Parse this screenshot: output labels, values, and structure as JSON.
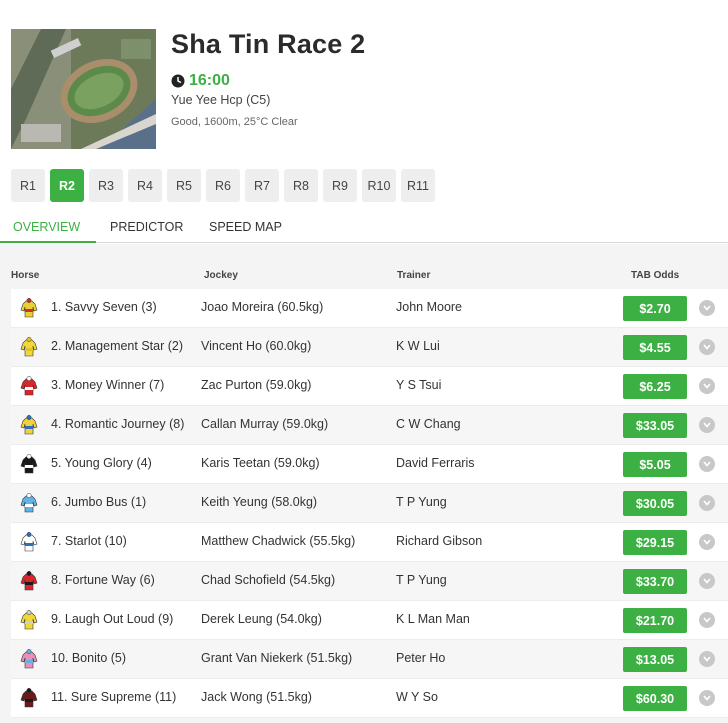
{
  "race": {
    "title": "Sha Tin Race 2",
    "time": "16:00",
    "name": "Yue Yee Hcp (C5)",
    "conditions": "Good, 1600m, 25°C Clear"
  },
  "race_tabs": [
    "R1",
    "R2",
    "R3",
    "R4",
    "R5",
    "R6",
    "R7",
    "R8",
    "R9",
    "R10",
    "R11"
  ],
  "active_race": "R2",
  "view_tabs": [
    "OVERVIEW",
    "PREDICTOR",
    "SPEED MAP"
  ],
  "active_view": "OVERVIEW",
  "columns": {
    "horse": "Horse",
    "jockey": "Jockey",
    "trainer": "Trainer",
    "odds": "TAB Odds"
  },
  "runners": [
    {
      "horse": "1. Savvy Seven (3)",
      "jockey": "Joao Moreira (60.5kg)",
      "trainer": "John Moore",
      "odds": "$2.70",
      "silk": [
        "#e8d232",
        "#d92b2b"
      ]
    },
    {
      "horse": "2. Management Star (2)",
      "jockey": "Vincent Ho (60.0kg)",
      "trainer": "K W Lui",
      "odds": "$4.55",
      "silk": [
        "#f0d83a",
        "#e3c02a"
      ]
    },
    {
      "horse": "3. Money Winner (7)",
      "jockey": "Zac Purton (59.0kg)",
      "trainer": "Y S Tsui",
      "odds": "$6.25",
      "silk": [
        "#d9262c",
        "#ffffff"
      ]
    },
    {
      "horse": "4. Romantic Journey (8)",
      "jockey": "Callan Murray (59.0kg)",
      "trainer": "C W Chang",
      "odds": "$33.05",
      "silk": [
        "#f2d23a",
        "#2a6fc4"
      ]
    },
    {
      "horse": "5. Young Glory (4)",
      "jockey": "Karis Teetan (59.0kg)",
      "trainer": "David Ferraris",
      "odds": "$5.05",
      "silk": [
        "#1a1a1a",
        "#ffffff"
      ]
    },
    {
      "horse": "6. Jumbo Bus (1)",
      "jockey": "Keith Yeung (58.0kg)",
      "trainer": "T P Yung",
      "odds": "$30.05",
      "silk": [
        "#5fb3e6",
        "#ffffff"
      ]
    },
    {
      "horse": "7. Starlot (10)",
      "jockey": "Matthew Chadwick (55.5kg)",
      "trainer": "Richard Gibson",
      "odds": "$29.15",
      "silk": [
        "#ffffff",
        "#2a6fc4"
      ]
    },
    {
      "horse": "8. Fortune Way (6)",
      "jockey": "Chad Schofield (54.5kg)",
      "trainer": "T P Yung",
      "odds": "$33.70",
      "silk": [
        "#d9262c",
        "#1a1a1a"
      ]
    },
    {
      "horse": "9. Laugh Out Loud (9)",
      "jockey": "Derek Leung (54.0kg)",
      "trainer": "K L Man Man",
      "odds": "$21.70",
      "silk": [
        "#f0d83a",
        "#cfcfcf"
      ]
    },
    {
      "horse": "10. Bonito (5)",
      "jockey": "Grant Van Niekerk (51.5kg)",
      "trainer": "Peter Ho",
      "odds": "$13.05",
      "silk": [
        "#ea8fb8",
        "#5fb3e6"
      ]
    },
    {
      "horse": "11. Sure Supreme (11)",
      "jockey": "Jack Wong (51.5kg)",
      "trainer": "W Y So",
      "odds": "$60.30",
      "silk": [
        "#6b1a1a",
        "#1a1a1a"
      ]
    }
  ],
  "colors": {
    "accent": "#3cb043",
    "tab_bg": "#eeeeee",
    "list_bg": "#f4f4f4"
  },
  "icons": {
    "clock": "clock-icon",
    "expand": "chevron-down-icon",
    "thumbnail": "racecourse-aerial-image"
  }
}
